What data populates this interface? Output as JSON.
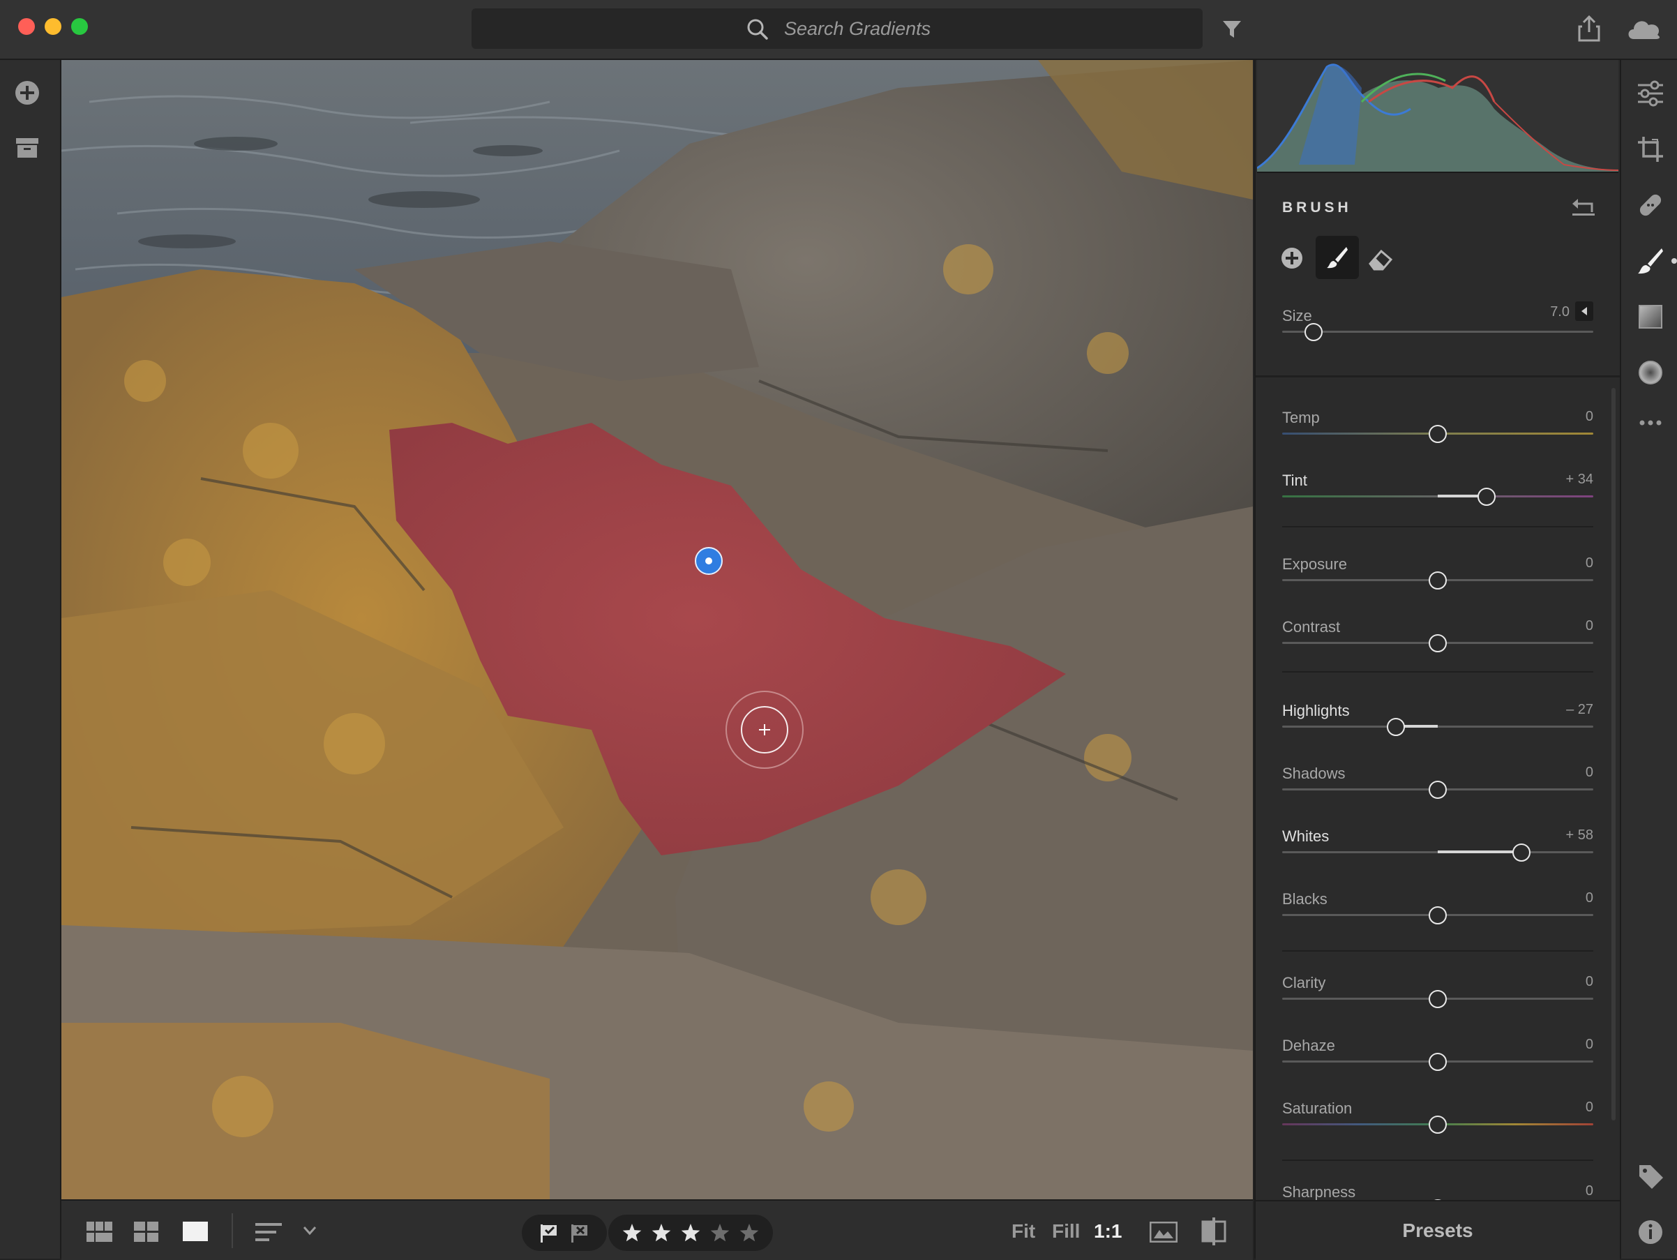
{
  "search": {
    "placeholder": "Search Gradients"
  },
  "panel": {
    "title": "BRUSH",
    "size": {
      "label": "Size",
      "value": "7.0"
    },
    "sliders": [
      {
        "label": "Temp",
        "value": "0"
      },
      {
        "label": "Tint",
        "value": "+ 34"
      },
      {
        "label": "Exposure",
        "value": "0"
      },
      {
        "label": "Contrast",
        "value": "0"
      },
      {
        "label": "Highlights",
        "value": "– 27"
      },
      {
        "label": "Shadows",
        "value": "0"
      },
      {
        "label": "Whites",
        "value": "+ 58"
      },
      {
        "label": "Blacks",
        "value": "0"
      },
      {
        "label": "Clarity",
        "value": "0"
      },
      {
        "label": "Dehaze",
        "value": "0"
      },
      {
        "label": "Saturation",
        "value": "0"
      },
      {
        "label": "Sharpness",
        "value": "0"
      }
    ]
  },
  "bottom_bar": {
    "fit": "Fit",
    "fill": "Fill",
    "one_to_one": "1:1",
    "rating_stars": 3,
    "rating_max": 5
  },
  "presets_label": "Presets",
  "colors": {
    "accent_blue": "#2f7de1",
    "mask_overlay": "#a8353e",
    "traffic_red": "#ff5f57",
    "traffic_yellow": "#febc2e",
    "traffic_green": "#28c840"
  }
}
